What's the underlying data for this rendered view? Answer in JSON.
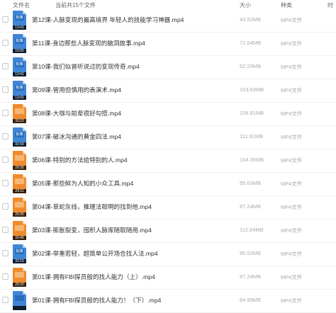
{
  "header": {
    "name_label": "文件名",
    "count_label": "当前共15个文件",
    "size_label": "大小",
    "kind_label": "种类",
    "time_label": "时"
  },
  "files": [
    {
      "name": "第12课-人脉变现的最高境界 年轻人的技能学习神器.mp4",
      "size": "43.52MB",
      "kind": "MP4文件",
      "duration": "13:41",
      "thumb": "标准",
      "thumb_color": "blue"
    },
    {
      "name": "第11课-身边那些人脉变现的脑洞故事.mp4",
      "size": "72.64MB",
      "kind": "MP4文件",
      "duration": "19:05",
      "thumb": "标准",
      "thumb_color": "blue"
    },
    {
      "name": "第10课-我们似曾听说过的变现传奇.mp4",
      "size": "52.25MB",
      "kind": "MP4文件",
      "duration": "13:41",
      "thumb": "标准",
      "thumb_color": "blue"
    },
    {
      "name": "第09课-管用但慎用的表演术.mp4",
      "size": "103.63MB",
      "kind": "MP4文件",
      "duration": "13:41",
      "thumb": "标准",
      "thumb_color": "blue"
    },
    {
      "name": "第08课-大咖与前辈很好勾搭.mp4",
      "size": "108.81MB",
      "kind": "MP4文件",
      "duration": "33:22",
      "thumb": "",
      "thumb_color": "orange"
    },
    {
      "name": "第07课-破冰沟通的黄金四法.mp4",
      "size": "111.91MB",
      "kind": "MP4文件",
      "duration": "31:59",
      "thumb": "标准",
      "thumb_color": "blue"
    },
    {
      "name": "第06课-特别的方法给特别的人.mp4",
      "size": "104.35MB",
      "kind": "MP4文件",
      "duration": "29:35",
      "thumb": "",
      "thumb_color": "orange"
    },
    {
      "name": "第05课-那些鲜为人知的小众工具.mp4",
      "size": "95.63MB",
      "kind": "MP4文件",
      "duration": "29:11",
      "thumb": "",
      "thumb_color": "orange"
    },
    {
      "name": "第04课-草蛇灰线，推理法聪明的找到他.mp4",
      "size": "97.24MB",
      "kind": "MP4文件",
      "duration": "29:35",
      "thumb": "",
      "thumb_color": "orange"
    },
    {
      "name": "第03课-膨胀裂变，囤积人脉库随取随用.mp4",
      "size": "112.64MB",
      "kind": "MP4文件",
      "duration": "33:46",
      "thumb": "",
      "thumb_color": "orange"
    },
    {
      "name": "第02课-举重若轻，超简单公开场合找人法.mp4",
      "size": "95.02MB",
      "kind": "MP4文件",
      "duration": "33:15",
      "thumb": "标准",
      "thumb_color": "blue"
    },
    {
      "name": "第01课-拥有FBI探员般的找人能力（上）.mp4",
      "size": "97.24MB",
      "kind": "MP4文件",
      "duration": "29:20",
      "thumb": "",
      "thumb_color": "orange"
    },
    {
      "name": "第01课-拥有FBI探员般的找人能力！（下）.mp4",
      "size": "84.99MB",
      "kind": "MP4文件",
      "duration": "",
      "thumb": "",
      "thumb_color": "blue"
    }
  ]
}
